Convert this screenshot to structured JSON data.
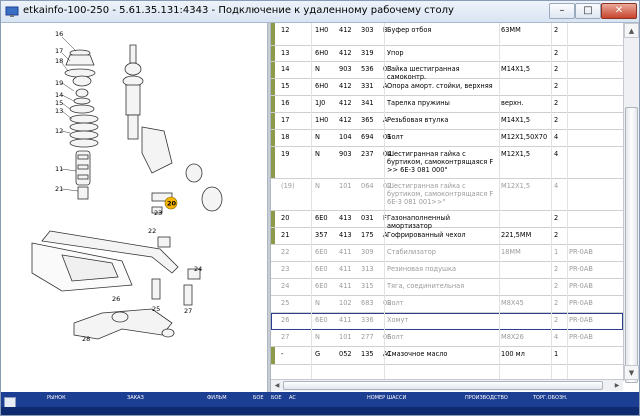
{
  "window": {
    "title": "etkainfo-100-250 - 5.61.35.131:4343 - Подключение к удаленному рабочему столу",
    "min_glyph": "–",
    "max_glyph": "□",
    "close_glyph": "✕"
  },
  "diagram": {
    "callouts": [
      "16",
      "17",
      "18",
      "19",
      "14",
      "15",
      "13",
      "12",
      "11",
      "21",
      "20",
      "23",
      "22",
      "24",
      "26",
      "25",
      "27",
      "28"
    ],
    "highlighted_callout": "20"
  },
  "parts_table": {
    "rows": [
      {
        "pos": "12",
        "a": "1H0",
        "b": "412",
        "c": "303",
        "d": "B",
        "name": "Буфер отбоя",
        "spec": "63MM",
        "qty": "2",
        "note": "",
        "gray": false,
        "bar": true
      },
      {
        "pos": "13",
        "a": "6H0",
        "b": "412",
        "c": "319",
        "d": "",
        "name": "Упор",
        "spec": "",
        "qty": "2",
        "note": "",
        "gray": false,
        "bar": true
      },
      {
        "pos": "14",
        "a": "N",
        "b": "903",
        "c": "536",
        "d": "03",
        "name": "Гайка шестигранная самоконтр.",
        "spec": "M14X1,5",
        "qty": "2",
        "note": "",
        "gray": false,
        "bar": true
      },
      {
        "pos": "15",
        "a": "6H0",
        "b": "412",
        "c": "331",
        "d": "A",
        "name": "Опора аморт. стойки, верхняя",
        "spec": "",
        "qty": "2",
        "note": "",
        "gray": false,
        "bar": true
      },
      {
        "pos": "16",
        "a": "1J0",
        "b": "412",
        "c": "341",
        "d": "",
        "name": "Тарелка пружины",
        "spec": "верхн.",
        "qty": "2",
        "note": "",
        "gray": false,
        "bar": true
      },
      {
        "pos": "17",
        "a": "1H0",
        "b": "412",
        "c": "365",
        "d": "A",
        "name": "Резьбовая втулка",
        "spec": "M14X1,5",
        "qty": "2",
        "note": "",
        "gray": false,
        "bar": true
      },
      {
        "pos": "18",
        "a": "N",
        "b": "104",
        "c": "694",
        "d": "01",
        "name": "Болт",
        "spec": "M12X1,50X70",
        "qty": "4",
        "note": "",
        "gray": false,
        "bar": true
      },
      {
        "pos": "19",
        "a": "N",
        "b": "903",
        "c": "237",
        "d": "04",
        "name": "Шестигранная гайка с буртиком, самоконтрящаяся F >> 6E-3 081 000\"",
        "spec": "M12X1,5",
        "qty": "4",
        "note": "",
        "gray": false,
        "bar": true
      },
      {
        "pos": "(19)",
        "a": "N",
        "b": "101",
        "c": "064",
        "d": "02",
        "name": "Шестигранная гайка с буртиком, самоконтрящаяся F 6E-3 081 001>>\"",
        "spec": "M12X1,5",
        "qty": "4",
        "note": "",
        "gray": true,
        "bar": false
      },
      {
        "pos": "20",
        "a": "6E0",
        "b": "413",
        "c": "031",
        "d": "F",
        "name": "Газонаполненный амортизатор",
        "spec": "",
        "qty": "2",
        "note": "",
        "gray": false,
        "bar": true
      },
      {
        "pos": "21",
        "a": "357",
        "b": "413",
        "c": "175",
        "d": "A",
        "name": "Гофрированный чехол",
        "spec": "221,5MM",
        "qty": "2",
        "note": "",
        "gray": false,
        "bar": true
      },
      {
        "pos": "22",
        "a": "6E0",
        "b": "411",
        "c": "309",
        "d": "",
        "name": "Стабилизатор",
        "spec": "18MM",
        "qty": "1",
        "note": "PR-0AB",
        "gray": true,
        "bar": false
      },
      {
        "pos": "23",
        "a": "6E0",
        "b": "411",
        "c": "313",
        "d": "",
        "name": "Резиновая подушка",
        "spec": "",
        "qty": "2",
        "note": "PR-0AB",
        "gray": true,
        "bar": false
      },
      {
        "pos": "24",
        "a": "6E0",
        "b": "411",
        "c": "315",
        "d": "",
        "name": "Тяга, соединительная",
        "spec": "",
        "qty": "2",
        "note": "PR-0AB",
        "gray": true,
        "bar": false
      },
      {
        "pos": "25",
        "a": "N",
        "b": "102",
        "c": "683",
        "d": "02",
        "name": "Болт",
        "spec": "M8X45",
        "qty": "2",
        "note": "PR-0AB",
        "gray": true,
        "bar": false
      },
      {
        "pos": "26",
        "a": "6E0",
        "b": "411",
        "c": "336",
        "d": "",
        "name": "Хомут",
        "spec": "",
        "qty": "2",
        "note": "PR-0AB",
        "gray": true,
        "bar": false,
        "hl": true
      },
      {
        "pos": "27",
        "a": "N",
        "b": "101",
        "c": "277",
        "d": "06",
        "name": "Болт",
        "spec": "M8X26",
        "qty": "4",
        "note": "PR-0AB",
        "gray": true,
        "bar": false
      },
      {
        "pos": "-",
        "a": "G",
        "b": "052",
        "c": "135",
        "d": "A1",
        "name": "Смазочное масло",
        "spec": "100 мл",
        "qty": "1",
        "note": "",
        "gray": false,
        "bar": true
      }
    ]
  },
  "taskbar": {
    "labels": [
      "РЫНОК",
      "ЗАКАЗ",
      "ФИЛЬМ",
      "БОЕ",
      "БОЕ",
      "АС",
      "НОМЕР ШАССИ",
      "ПРОИЗВОДСТВО",
      "ТОРГ.ОБОЗН."
    ]
  }
}
